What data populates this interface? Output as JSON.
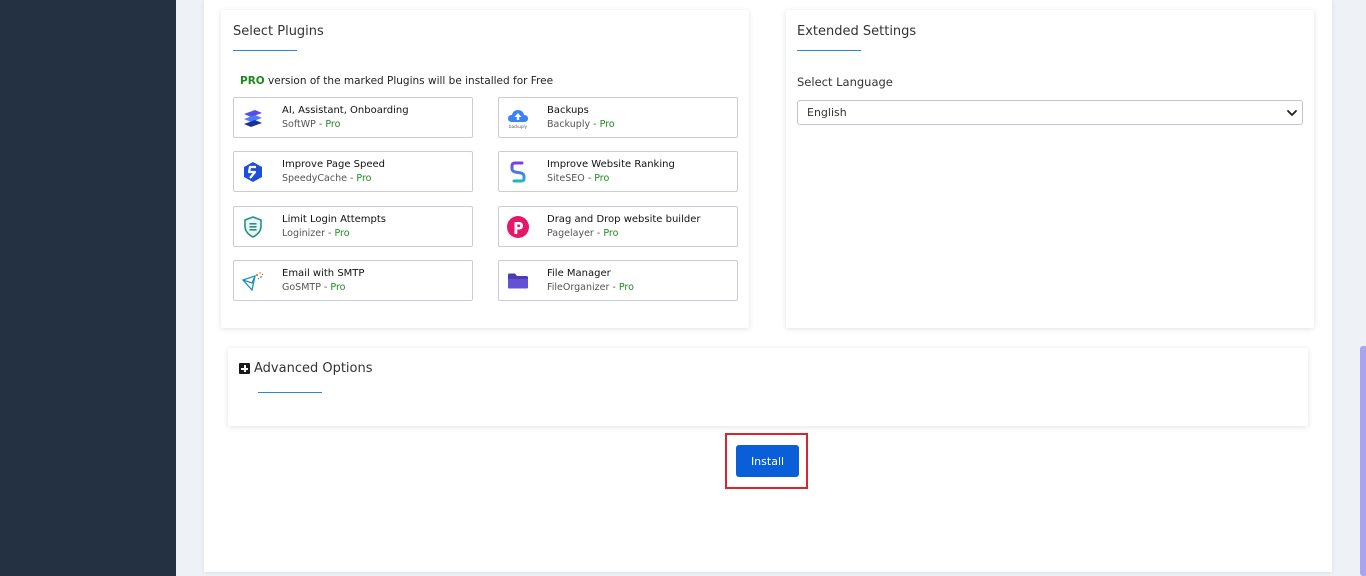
{
  "plugins_section": {
    "title": "Select Plugins",
    "note_pro": "PRO",
    "note_text": " version of the marked Plugins will be installed for Free",
    "plugins": [
      {
        "name": "AI, Assistant, Onboarding",
        "vendor": "SoftWP",
        "sep": " - ",
        "pro": "Pro",
        "icon": "softwp-icon"
      },
      {
        "name": "Backups",
        "vendor": "Backuply",
        "sep": " - ",
        "pro": "Pro",
        "icon": "backuply-cloud-icon"
      },
      {
        "name": "Improve Page Speed",
        "vendor": "SpeedyCache",
        "sep": " - ",
        "pro": "Pro",
        "icon": "speedycache-icon"
      },
      {
        "name": "Improve Website Ranking",
        "vendor": "SiteSEO",
        "sep": " - ",
        "pro": "Pro",
        "icon": "siteseo-icon"
      },
      {
        "name": "Limit Login Attempts",
        "vendor": "Loginizer",
        "sep": " - ",
        "pro": "Pro",
        "icon": "loginizer-shield-icon"
      },
      {
        "name": "Drag and Drop website builder",
        "vendor": "Pagelayer",
        "sep": " - ",
        "pro": "Pro",
        "icon": "pagelayer-icon"
      },
      {
        "name": "Email with SMTP",
        "vendor": "GoSMTP",
        "sep": " - ",
        "pro": "Pro",
        "icon": "gosmtp-icon"
      },
      {
        "name": "File Manager",
        "vendor": "FileOrganizer",
        "sep": " - ",
        "pro": "Pro",
        "icon": "fileorganizer-folder-icon"
      }
    ]
  },
  "extended_settings": {
    "title": "Extended Settings",
    "language_label": "Select Language",
    "language_value": "English"
  },
  "advanced": {
    "title": "Advanced Options"
  },
  "install_label": "Install",
  "colors": {
    "sidebar": "#243142",
    "accent_blue": "#0a5fd8",
    "pro_green": "#1e8a1e",
    "highlight_red": "#d9252c"
  }
}
